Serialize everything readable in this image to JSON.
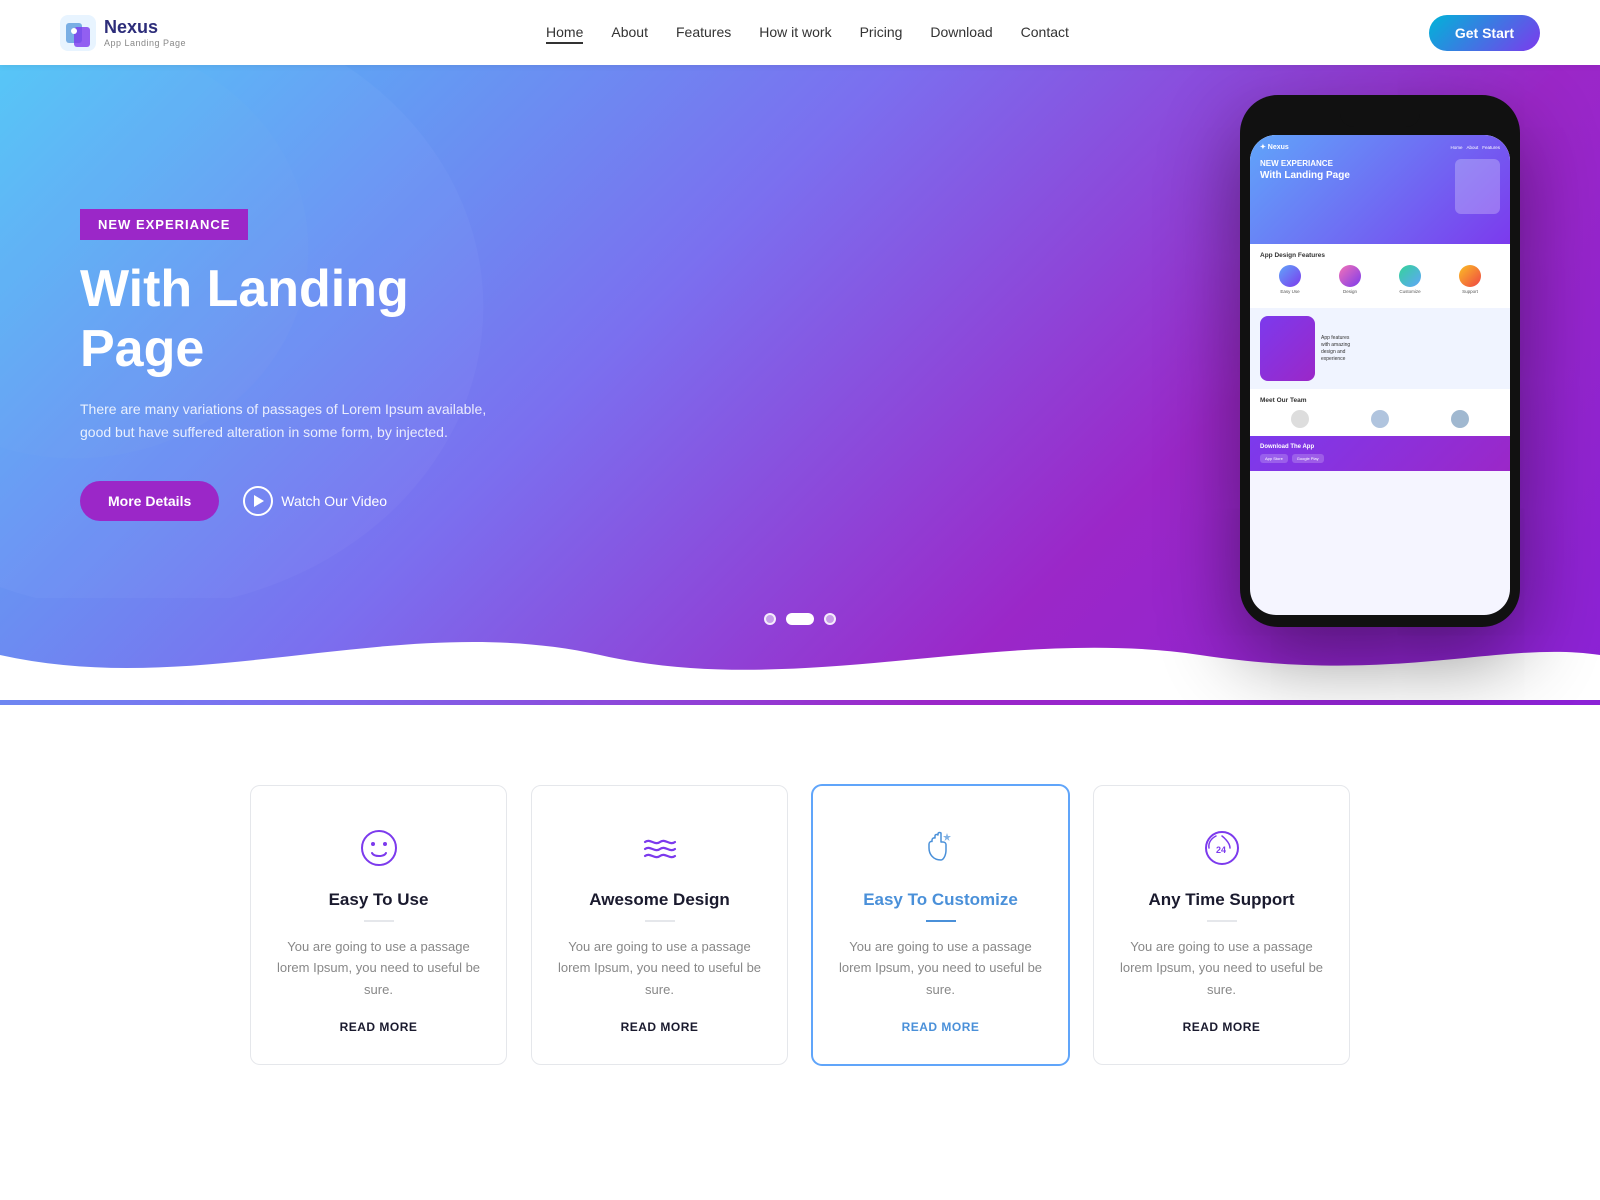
{
  "navbar": {
    "logo_title": "Nexus",
    "logo_sub": "App Landing Page",
    "nav_items": [
      {
        "label": "Home",
        "active": true
      },
      {
        "label": "About",
        "active": false
      },
      {
        "label": "Features",
        "active": false
      },
      {
        "label": "How it work",
        "active": false
      },
      {
        "label": "Pricing",
        "active": false
      },
      {
        "label": "Download",
        "active": false
      },
      {
        "label": "Contact",
        "active": false
      }
    ],
    "cta_label": "Get Start"
  },
  "hero": {
    "badge": "NEW EXPERIANCE",
    "title": "With Landing Page",
    "description": "There are many variations of passages of Lorem Ipsum available, good but have suffered alteration in some form, by injected.",
    "btn_more": "More Details",
    "btn_video": "Watch Our Video",
    "dots": [
      {
        "active": false
      },
      {
        "active": true
      },
      {
        "active": false
      }
    ]
  },
  "features": {
    "cards": [
      {
        "icon": "smiley",
        "title": "Easy To Use",
        "desc": "You are going to use a passage lorem Ipsum, you need to useful be sure.",
        "read_more": "READ MORE",
        "active": false
      },
      {
        "icon": "waves",
        "title": "Awesome Design",
        "desc": "You are going to use a passage lorem Ipsum, you need to useful be sure.",
        "read_more": "READ MORE",
        "active": false
      },
      {
        "icon": "hand-stars",
        "title": "Easy To Customize",
        "desc": "You are going to use a passage lorem Ipsum, you need to useful be sure.",
        "read_more": "READ MORE",
        "active": true
      },
      {
        "icon": "clock-24",
        "title": "Any Time Support",
        "desc": "You are going to use a passage lorem Ipsum, you need to useful be sure.",
        "read_more": "READ MORE",
        "active": false
      }
    ]
  }
}
